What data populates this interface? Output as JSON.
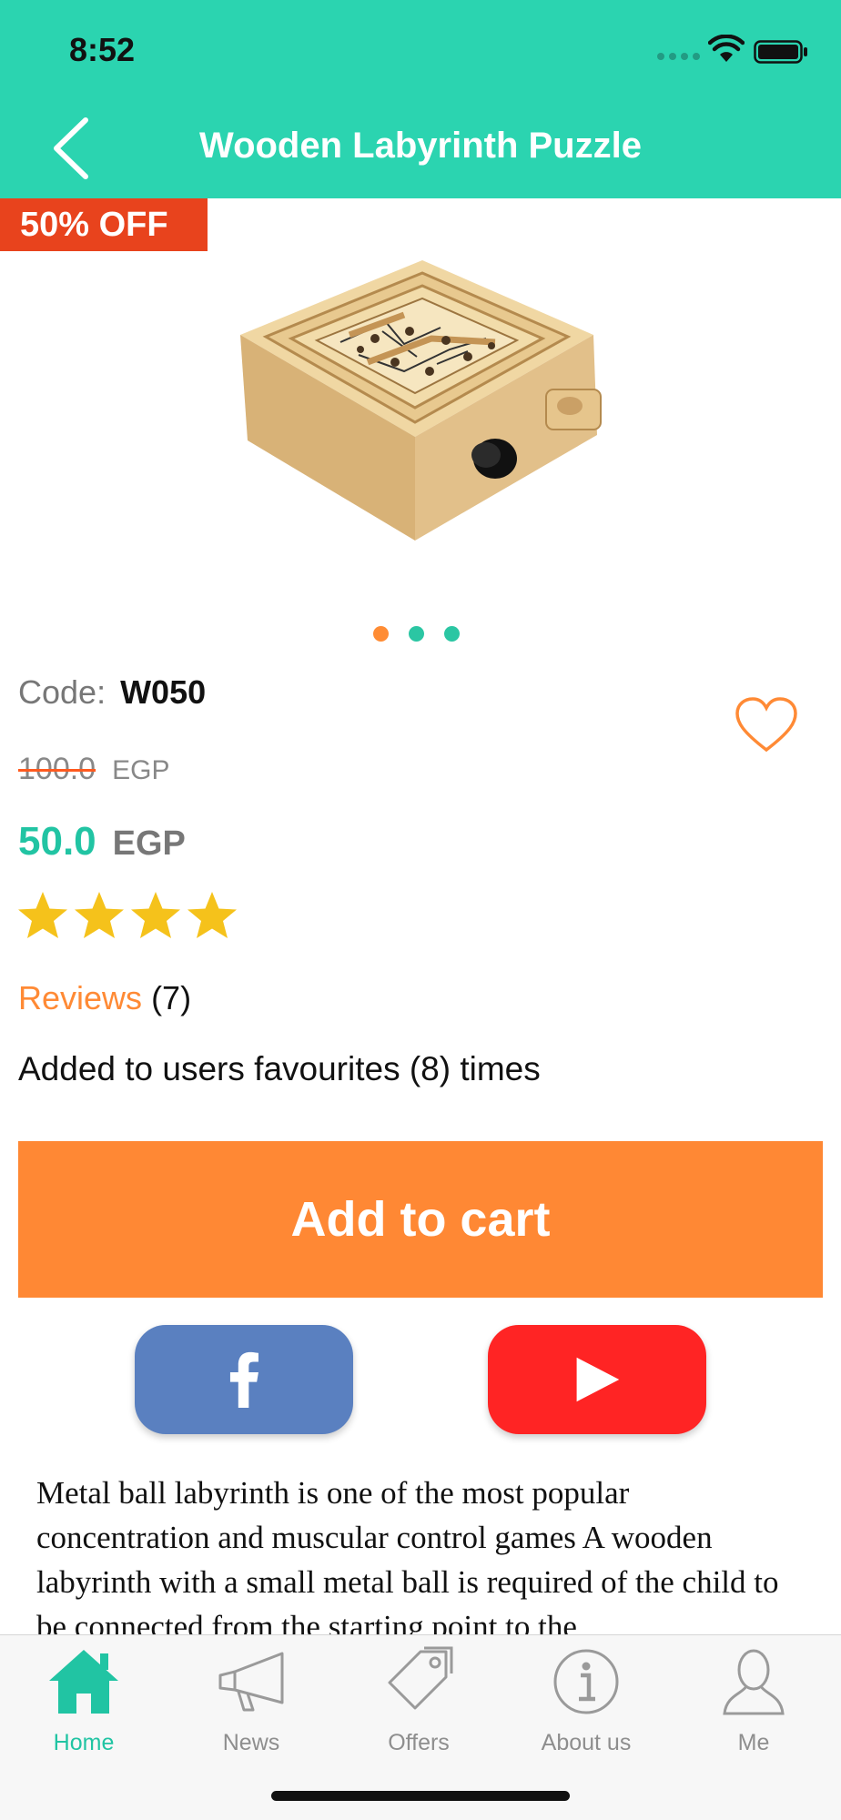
{
  "status_bar": {
    "time": "8:52"
  },
  "nav": {
    "title": "Wooden Labyrinth Puzzle",
    "back_icon": "chevron-left-icon"
  },
  "product": {
    "discount_badge": "50% OFF",
    "image_alt": "wooden labyrinth puzzle",
    "carousel": {
      "count": 3,
      "active_index": 0
    },
    "code_label": "Code:",
    "code_value": "W050",
    "old_price": "100.0",
    "old_currency": "EGP",
    "new_price": "50.0",
    "new_currency": "EGP",
    "rating": 4,
    "rating_max": 4,
    "reviews_label": "Reviews",
    "reviews_count": "(7)",
    "favourites_text": "Added to users favourites (8) times",
    "add_to_cart_label": "Add to cart",
    "description": "Metal ball labyrinth is one of the most popular concentration and muscular control games A wooden labyrinth with a small metal ball is required of the child to be connected from the starting point to the"
  },
  "social": {
    "facebook_icon": "facebook-icon",
    "youtube_icon": "youtube-play-icon"
  },
  "tabbar": {
    "tabs": [
      {
        "label": "Home",
        "icon": "home-icon",
        "active": true
      },
      {
        "label": "News",
        "icon": "megaphone-icon",
        "active": false
      },
      {
        "label": "Offers",
        "icon": "tags-icon",
        "active": false
      },
      {
        "label": "About us",
        "icon": "info-icon",
        "active": false
      },
      {
        "label": "Me",
        "icon": "user-icon",
        "active": false
      }
    ]
  },
  "colors": {
    "header": "#2bd4b0",
    "accent_orange": "#ff8834",
    "teal_price": "#21c4a3",
    "badge_red": "#e8431d",
    "star_yellow": "#f5c21b",
    "facebook_blue": "#5a80c0",
    "youtube_red": "#ff2424"
  }
}
